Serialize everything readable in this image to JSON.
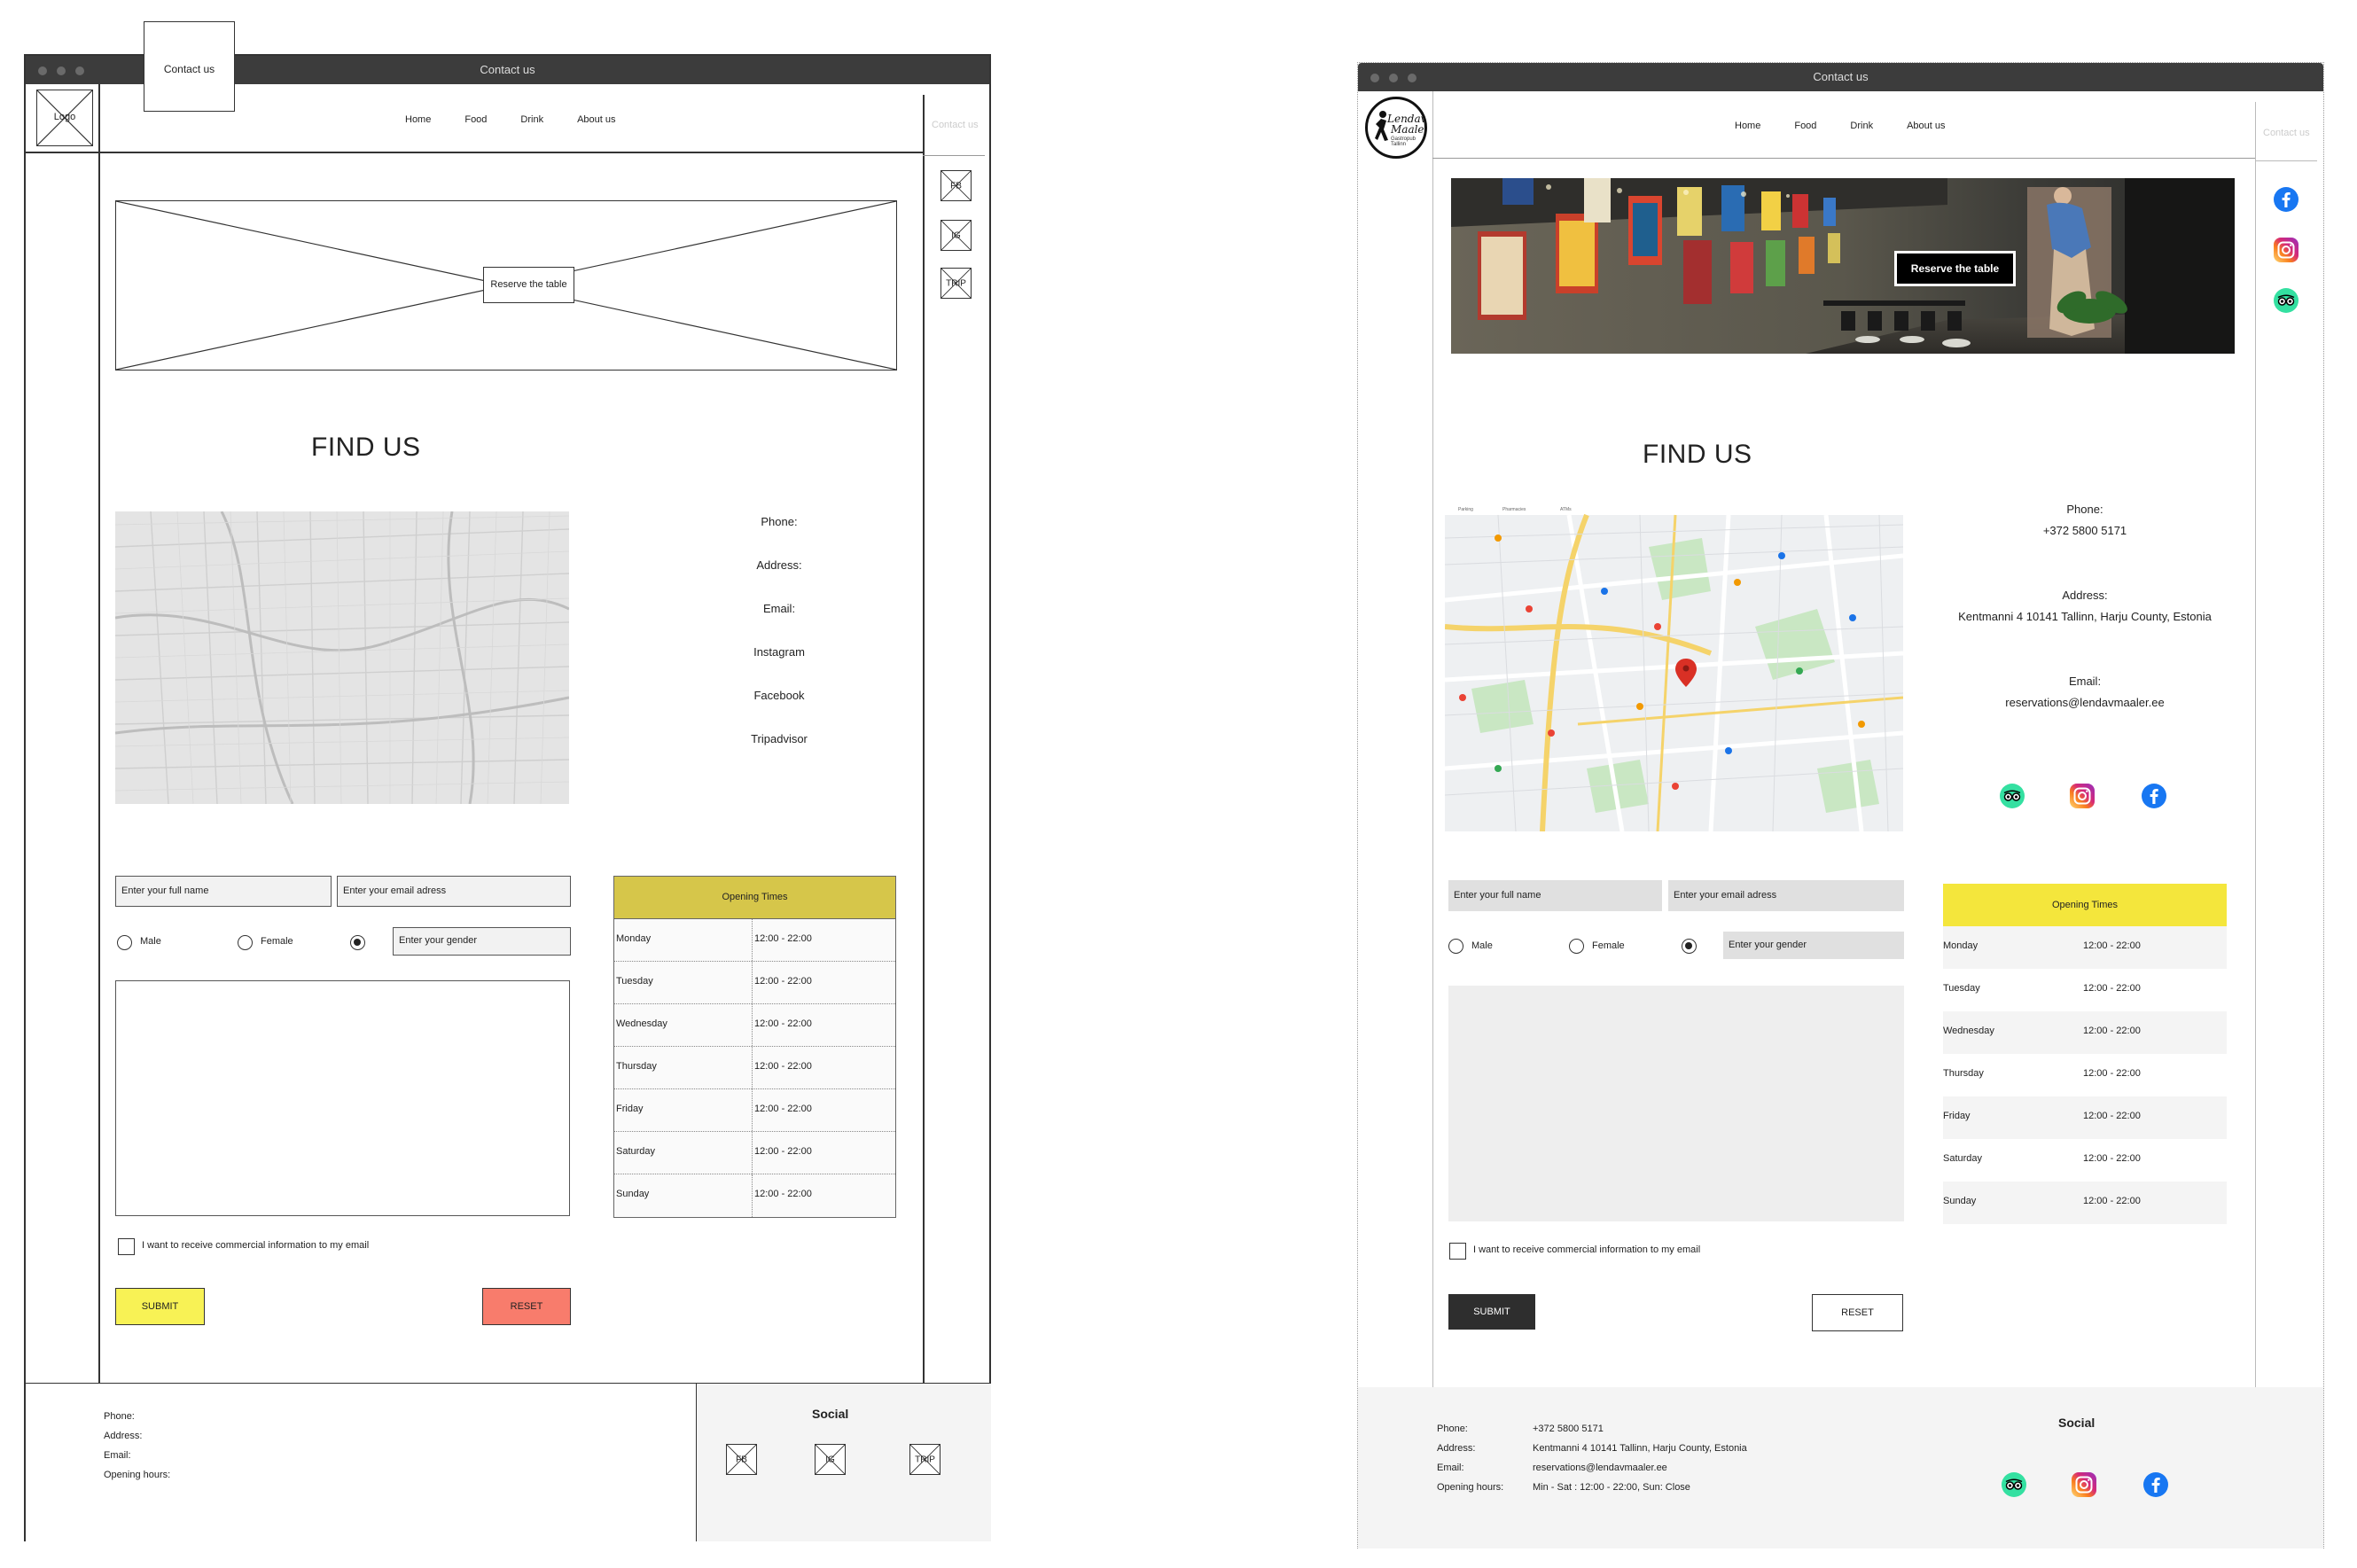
{
  "wireframe": {
    "window_title": "Contact us",
    "tab_label": "Contact us",
    "logo_label": "Logo",
    "nav": [
      "Home",
      "Food",
      "Drink",
      "About us"
    ],
    "contact_ghost": "Contact us",
    "social_side": [
      "FB",
      "IG",
      "TRIP"
    ],
    "hero_button": "Reserve the table",
    "find_us": "FIND US",
    "contact_labels": [
      "Phone:",
      "Address:",
      "Email:",
      "Instagram",
      "Facebook",
      "Tripadvisor"
    ],
    "form": {
      "name_placeholder": "Enter your full name",
      "email_placeholder": "Enter your email adress",
      "gender_male": "Male",
      "gender_female": "Female",
      "gender_other_placeholder": "Enter your gender",
      "newsletter_label": "I want to receive commercial information to my email",
      "submit": "SUBMIT",
      "reset": "RESET"
    },
    "hours": {
      "title": "Opening Times",
      "rows": [
        {
          "day": "Monday",
          "time": "12:00 - 22:00"
        },
        {
          "day": "Tuesday",
          "time": "12:00 - 22:00"
        },
        {
          "day": "Wednesday",
          "time": "12:00 - 22:00"
        },
        {
          "day": "Thursday",
          "time": "12:00 - 22:00"
        },
        {
          "day": "Friday",
          "time": "12:00 - 22:00"
        },
        {
          "day": "Saturday",
          "time": "12:00 - 22:00"
        },
        {
          "day": "Sunday",
          "time": "12:00 - 22:00"
        }
      ]
    },
    "footer": {
      "labels": [
        "Phone:",
        "Address:",
        "Email:",
        "Opening hours:"
      ],
      "social_title": "Social",
      "social": [
        "FB",
        "IG",
        "TRIP"
      ]
    }
  },
  "design": {
    "window_title": "Contact us",
    "logo_text": [
      "Lendav",
      "Maaler"
    ],
    "logo_sub": "Gastropub Tallinn",
    "nav": [
      "Home",
      "Food",
      "Drink",
      "About us"
    ],
    "contact_ghost": "Contact us",
    "social_side_icons": [
      "facebook-icon",
      "instagram-icon",
      "tripadvisor-icon"
    ],
    "hero_button": "Reserve the table",
    "find_us": "FIND US",
    "contact": {
      "phone_label": "Phone:",
      "phone": "+372 5800 5171",
      "address_label": "Address:",
      "address": "Kentmanni 4 10141 Tallinn, Harju County, Estonia",
      "email_label": "Email:",
      "email": "reservations@lendavmaaler.ee"
    },
    "map_labels": [
      "Parking",
      "Pharmacies",
      "ATMs"
    ],
    "form": {
      "name_placeholder": "Enter your full name",
      "email_placeholder": "Enter your email adress",
      "gender_male": "Male",
      "gender_female": "Female",
      "gender_other_placeholder": "Enter your gender",
      "newsletter_label": "I want to receive commercial information to my email",
      "submit": "SUBMIT",
      "reset": "RESET"
    },
    "hours": {
      "title": "Opening Times",
      "rows": [
        {
          "day": "Monday",
          "time": "12:00 - 22:00"
        },
        {
          "day": "Tuesday",
          "time": "12:00 - 22:00"
        },
        {
          "day": "Wednesday",
          "time": "12:00 - 22:00"
        },
        {
          "day": "Thursday",
          "time": "12:00 - 22:00"
        },
        {
          "day": "Friday",
          "time": "12:00 - 22:00"
        },
        {
          "day": "Saturday",
          "time": "12:00 - 22:00"
        },
        {
          "day": "Sunday",
          "time": "12:00 - 22:00"
        }
      ]
    },
    "footer": {
      "phone_label": "Phone:",
      "phone": "+372 5800 5171",
      "address_label": "Address:",
      "address": "Kentmanni 4 10141 Tallinn, Harju County, Estonia",
      "email_label": "Email:",
      "email": "reservations@lendavmaaler.ee",
      "hours_label": "Opening hours:",
      "hours": "Min - Sat : 12:00 - 22:00,  Sun: Close",
      "social_title": "Social"
    },
    "colors": {
      "accent_yellow": "#f4e63c",
      "wire_yellow": "#f8f255",
      "wire_reset": "#f87c6c",
      "hours_head_wire": "#d6c64a",
      "facebook": "#1877f2",
      "tripadvisor": "#34e0a1"
    }
  }
}
